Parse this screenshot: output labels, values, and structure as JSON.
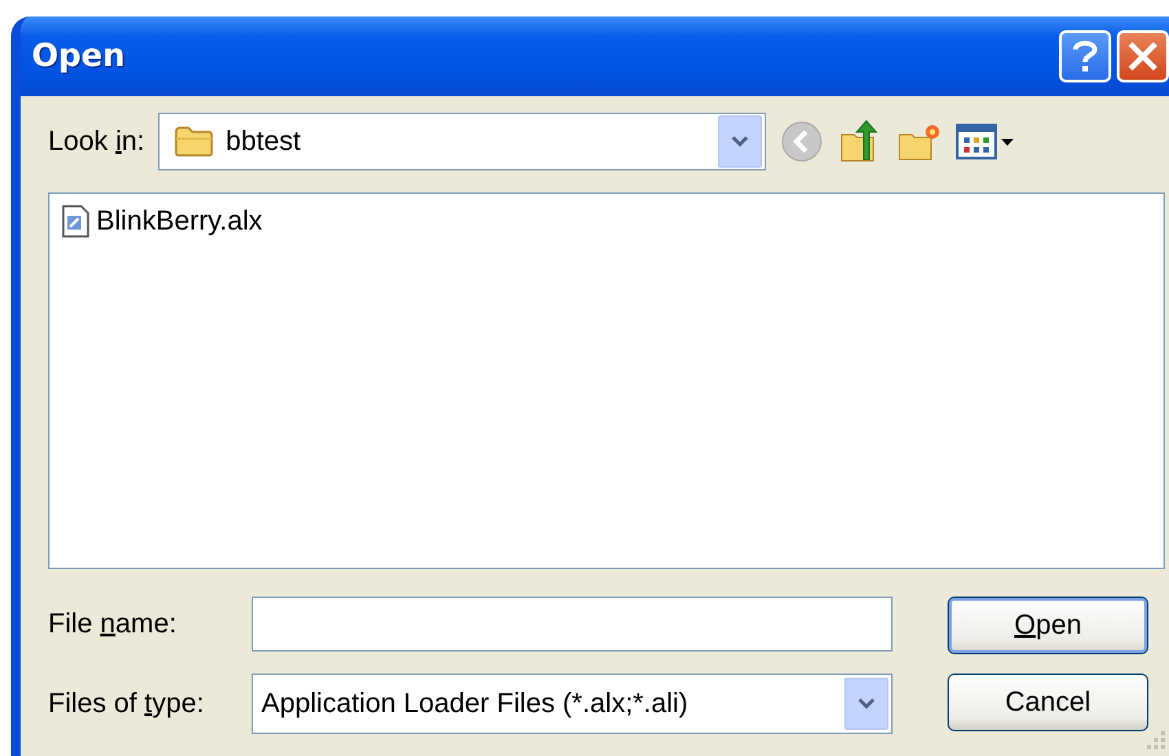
{
  "window": {
    "title": "Open"
  },
  "look_in": {
    "label": {
      "before": "Look ",
      "key": "i",
      "after": "n:"
    },
    "value": "bbtest"
  },
  "files": [
    {
      "name": "BlinkBerry.alx",
      "selected": false
    }
  ],
  "file_name": {
    "label": {
      "before": "File ",
      "key": "n",
      "after": "ame:"
    }
  },
  "file_type": {
    "label": {
      "before": "Files of ",
      "key": "t",
      "after": "ype:"
    },
    "value": "Application Loader Files (*.alx;*.ali)"
  },
  "buttons": [
    {
      "label": {
        "key": "O",
        "after": "pen"
      },
      "default": true
    },
    {
      "label": {
        "before": "Cancel"
      },
      "default": false
    }
  ]
}
